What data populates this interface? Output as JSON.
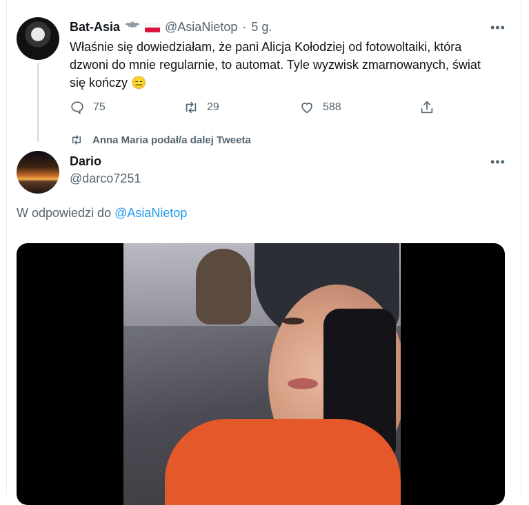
{
  "tweet1": {
    "name": "Bat-Asia",
    "handle": "@AsiaNietop",
    "separator": "·",
    "time": "5 g.",
    "line1": "Właśnie się dowiedziałam, że pani Alicja Kołodziej od fotowoltaiki, która",
    "line2": "dzwoni do mnie regularnie, to automat. Tyle wyzwisk zmarnowanych, świat",
    "line3": "się kończy",
    "emoji": "😑",
    "reply_count": "75",
    "retweet_count": "29",
    "like_count": "588",
    "more": "•••"
  },
  "retweet_note": "Anna Maria podał/a dalej Tweeta",
  "tweet2": {
    "name": "Dario",
    "handle": "@darco7251",
    "more": "•••",
    "reply_prefix": "W odpowiedzi do",
    "reply_handle": "@AsiaNietop"
  },
  "colors": {
    "link": "#1d9bf0",
    "secondary_text": "#536471",
    "primary_text": "#0f1419"
  },
  "icons": {
    "reply": "reply-icon",
    "retweet": "retweet-icon",
    "like": "heart-icon",
    "share": "share-icon",
    "bat": "bat-icon",
    "flag": "poland-flag-icon"
  }
}
